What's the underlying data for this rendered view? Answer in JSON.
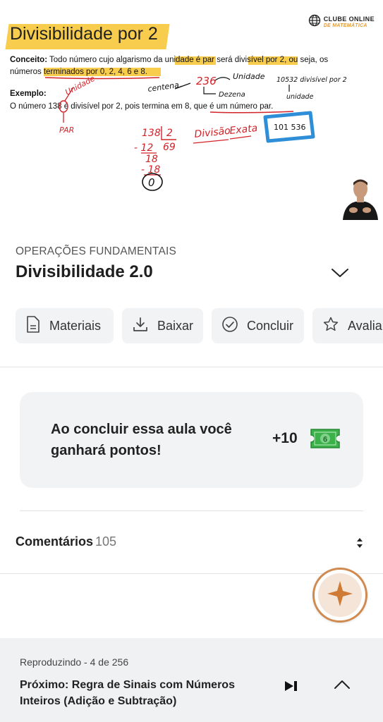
{
  "video": {
    "slide_title": "Divisibilidade por 2",
    "brand": {
      "line1": "CLUBE ONLINE",
      "line2": "DE MATEMÁTICA",
      "icon": "globe-icon"
    },
    "concept_label": "Conceito:",
    "concept_line1": "Todo número cujo algarismo da unidade é par será divisível por 2, ou seja, os",
    "concept_line2": "números terminados por 0, 2, 4, 6 e 8.",
    "example_label": "Exemplo:",
    "example_line": "O número 138 é divisível por 2, pois termina em 8, que é um número par.",
    "handwriting": {
      "unidade": "Unidade",
      "par": "PAR",
      "centena": "centena",
      "n236": "236",
      "unidade2": "Unidade",
      "dezena": "Dezena",
      "n10532": "10532 divisível por 2",
      "unidade3": "unidade",
      "divisao": "Divisão",
      "exata": "Exata",
      "n101536": "101 536",
      "d138": "138",
      "d2": "2",
      "dm12": "- 12",
      "d69": "69",
      "d18": "18",
      "dm18": "- 18",
      "d0": "0"
    }
  },
  "lesson": {
    "category": "OPERAÇÕES FUNDAMENTAIS",
    "title": "Divisibilidade 2.0"
  },
  "actions": [
    {
      "label": "Materiais",
      "icon": "document-icon"
    },
    {
      "label": "Baixar",
      "icon": "download-icon"
    },
    {
      "label": "Concluir",
      "icon": "check-circle-icon"
    },
    {
      "label": "Avaliar",
      "icon": "star-icon"
    }
  ],
  "points": {
    "message": "Ao concluir essa aula você ganhará pontos!",
    "value": "+10",
    "ticket_symbol": "6"
  },
  "comments": {
    "label": "Comentários",
    "count": "105"
  },
  "player": {
    "status": "Reproduzindo - 4 de 256",
    "next": "Próximo: Regra de Sinais com Números Inteiros (Adição e Subtração)"
  },
  "colors": {
    "highlight": "#f7c32e",
    "ink_red": "#d3232a",
    "ink_blue": "#2e8fd8",
    "ticket_green": "#3bb14a",
    "fab_orange": "#d08a4f"
  }
}
